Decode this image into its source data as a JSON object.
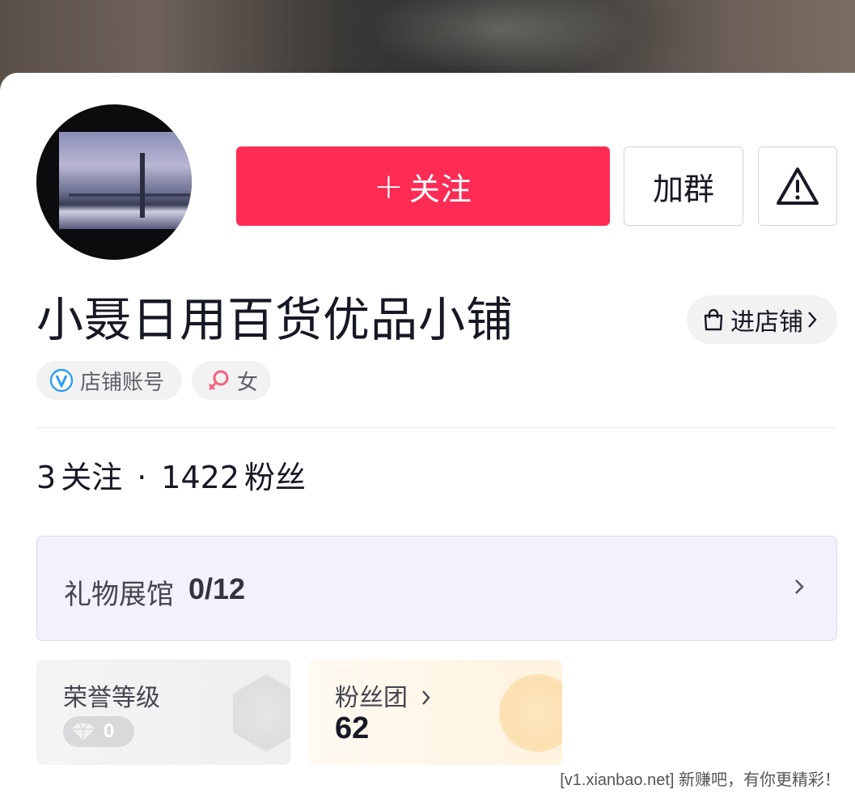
{
  "profile": {
    "name": "小聂日用百货优品小铺",
    "follow_label": "关注",
    "follow_plus": "+",
    "group_label": "加群",
    "enter_shop_label": "进店铺",
    "tags": {
      "account": "店铺账号",
      "gender": "女"
    }
  },
  "stats": {
    "following_count": "3",
    "following_label": "关注",
    "separator": "·",
    "followers_count": "1422",
    "followers_label": "粉丝"
  },
  "gift_hall": {
    "label": "礼物展馆",
    "count": "0/12"
  },
  "honor": {
    "title": "荣誉等级",
    "level": "0"
  },
  "fan_club": {
    "title": "粉丝团",
    "count": "62"
  },
  "watermark": "[v1.xianbao.net] 新赚吧，有你更精彩！",
  "colors": {
    "follow_button": "#fe2c55",
    "gift_hall_bg": "#f3f1fe",
    "verified_badge": "#2a9df4",
    "gender_female": "#f5607f"
  },
  "icons": {
    "report": "warning-triangle-icon",
    "shop": "shopping-bag-icon",
    "verified": "verified-v-icon",
    "gender": "female-symbol-icon",
    "chevron": "chevron-right-icon",
    "level": "diamond-icon"
  }
}
